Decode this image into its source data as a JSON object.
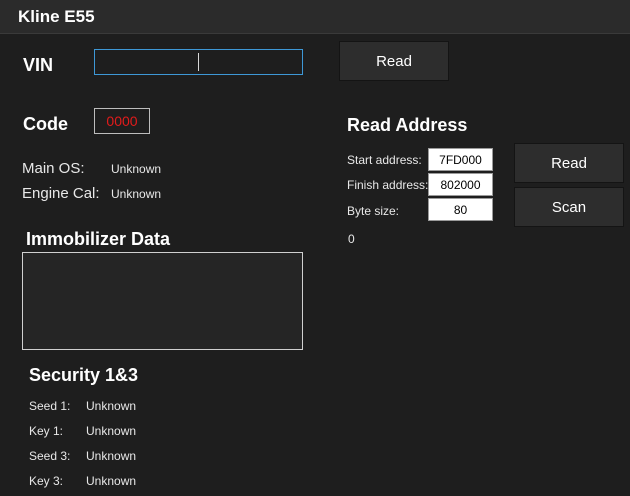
{
  "window": {
    "title": "Kline E55"
  },
  "vin": {
    "label": "VIN",
    "value": "",
    "read_label": "Read"
  },
  "code": {
    "label": "Code",
    "value": "0000"
  },
  "info": [
    {
      "label": "Main OS:",
      "value": "Unknown"
    },
    {
      "label": "Engine Cal:",
      "value": "Unknown"
    }
  ],
  "immobilizer": {
    "title": "Immobilizer Data",
    "content": ""
  },
  "security": {
    "title": "Security 1&3",
    "rows": [
      {
        "label": "Seed 1:",
        "value": "Unknown"
      },
      {
        "label": "Key 1:",
        "value": "Unknown"
      },
      {
        "label": "Seed 3:",
        "value": "Unknown"
      },
      {
        "label": "Key 3:",
        "value": "Unknown"
      }
    ]
  },
  "read_address": {
    "title": "Read Address",
    "start_label": "Start address:",
    "start_value": "7FD000",
    "finish_label": "Finish address:",
    "finish_value": "802000",
    "size_label": "Byte size:",
    "size_value": "80",
    "read_label": "Read",
    "scan_label": "Scan",
    "status": "0"
  },
  "colors": {
    "accent": "#3e98d6",
    "code_text": "#e21b1b",
    "background": "#1e1e1e"
  }
}
